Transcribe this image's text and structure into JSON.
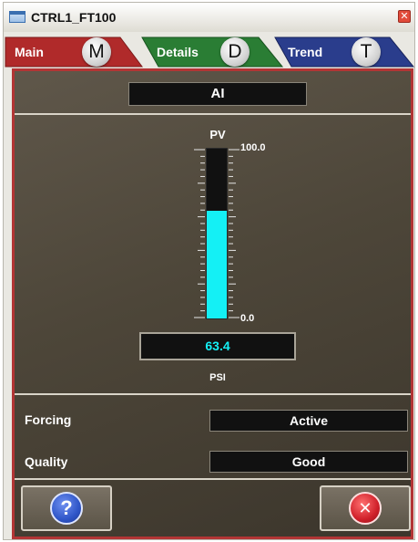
{
  "window": {
    "title": "CTRL1_FT100",
    "icon": "window-icon"
  },
  "tabs": [
    {
      "label": "Main",
      "shortcut": "M",
      "color": "#b02a2a",
      "active": true
    },
    {
      "label": "Details",
      "shortcut": "D",
      "color": "#2a7d34"
    },
    {
      "label": "Trend",
      "shortcut": "T",
      "color": "#2a3d8c"
    }
  ],
  "main": {
    "block_type": "AI",
    "pv": {
      "label": "PV",
      "max_label": "100.0",
      "min_label": "0.0",
      "value": "63.4",
      "fraction": 0.634,
      "unit": "PSI",
      "fill_color": "#14f0f5"
    },
    "forcing": {
      "label": "Forcing",
      "value": "Active"
    },
    "quality": {
      "label": "Quality",
      "value": "Good"
    }
  },
  "buttons": {
    "help": {
      "icon": "help-icon",
      "glyph": "?",
      "color": "#2f56c8"
    },
    "close": {
      "icon": "close-icon",
      "glyph": "✕",
      "color": "#d0202a"
    }
  },
  "colors": {
    "accent_border": "#b23535",
    "panel": "#4d4639"
  }
}
